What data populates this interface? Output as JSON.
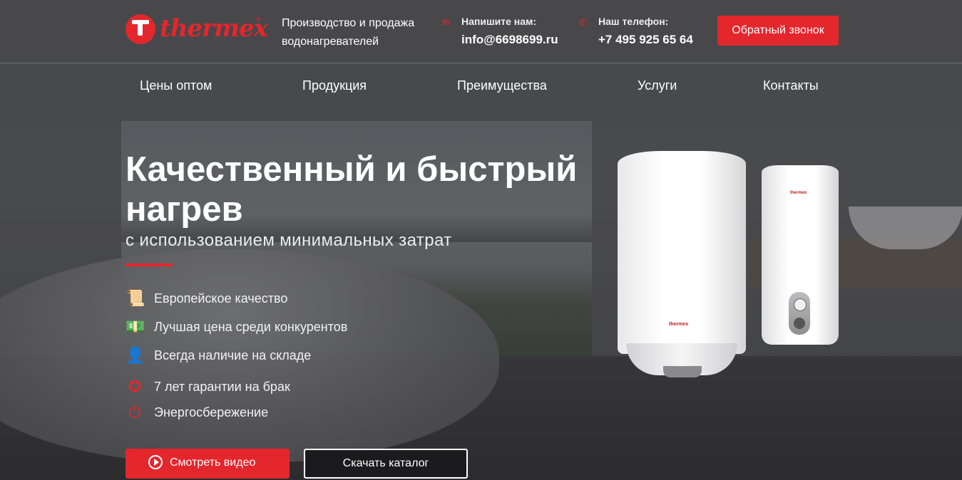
{
  "brand": {
    "name": "thermex",
    "accent": "#e4262d"
  },
  "header": {
    "tagline": "Производство и продажа водонагревателей",
    "email_label": "Напишите нам:",
    "email_value": "info@6698699.ru",
    "phone_label": "Наш телефон:",
    "phone_value": "+7 495 925 65 64",
    "callback_label": "Обратный звонок"
  },
  "nav": {
    "items": [
      "Цены оптом",
      "Продукция",
      "Преимущества",
      "Услуги",
      "Контакты"
    ]
  },
  "hero": {
    "title": "Качественный и быстрый нагрев",
    "subtitle": "с использованием минимальных затрат",
    "features": [
      {
        "icon": "certificate-icon",
        "text": "Европейское качество"
      },
      {
        "icon": "money-stack-icon",
        "text": "Лучшая цена среди конкурентов"
      },
      {
        "icon": "warehouse-person-icon",
        "text": "Всегда наличие на складе"
      },
      {
        "icon": "award-badge-icon",
        "text": "7 лет гарантии на брак"
      },
      {
        "icon": "plug-icon",
        "text": "Энергосбережение"
      }
    ],
    "video_button": "Смотреть видео",
    "catalog_button": "Скачать каталог"
  }
}
